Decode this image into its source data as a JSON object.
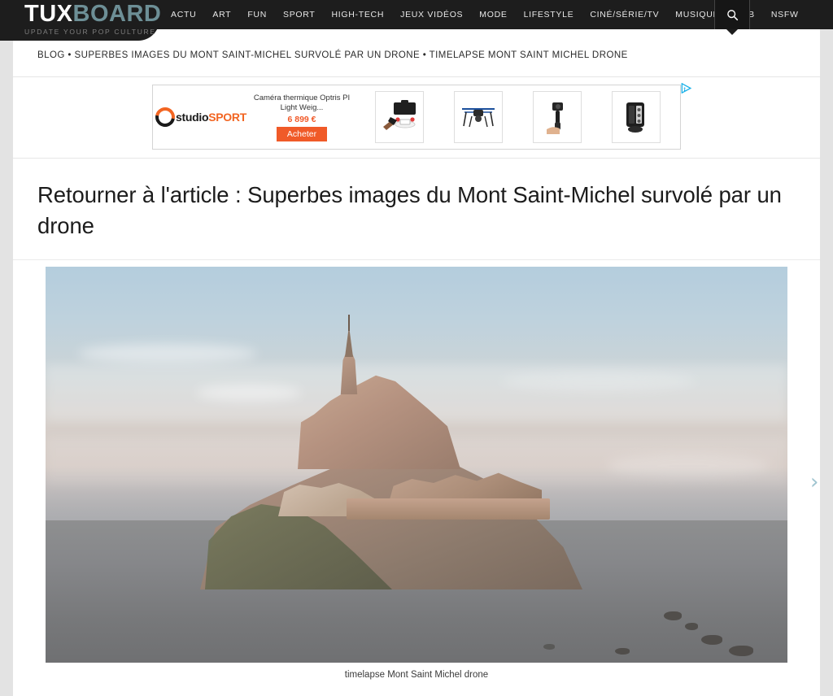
{
  "site": {
    "logo_primary": "TUX",
    "logo_secondary": "BOARD",
    "tagline": "UPDATE YOUR POP CULTURE",
    "accent_color": "#6d8f96",
    "header_bg": "#1d1d1d"
  },
  "nav": {
    "items": [
      {
        "label": "ACTU"
      },
      {
        "label": "ART"
      },
      {
        "label": "FUN"
      },
      {
        "label": "SPORT"
      },
      {
        "label": "HIGH-TECH"
      },
      {
        "label": "JEUX VIDÉOS"
      },
      {
        "label": "MODE"
      },
      {
        "label": "LIFESTYLE"
      },
      {
        "label": "CINÉ/SÉRIE/TV"
      },
      {
        "label": "MUSIQUE"
      },
      {
        "label": "PUB"
      },
      {
        "label": "NSFW"
      }
    ],
    "search_icon": "search-icon"
  },
  "breadcrumb": {
    "text": "BLOG • SUPERBES IMAGES DU MONT SAINT-MICHEL SURVOLÉ PAR UN DRONE • TIMELAPSE MONT SAINT MICHEL DRONE"
  },
  "ad": {
    "brand_part1": "studio",
    "brand_part2": "SPORT",
    "product_title": "Caméra thermique Optris PI Light Weig...",
    "price": "6 899 €",
    "price_color": "#f15a29",
    "buy_label": "Acheter",
    "adchoices_icon": "adchoices-icon",
    "thumbnails": [
      {
        "name": "drone-case-thumbnail"
      },
      {
        "name": "blue-quadcopter-thumbnail"
      },
      {
        "name": "gimbal-stabilizer-thumbnail"
      },
      {
        "name": "action-camera-thumbnail"
      }
    ]
  },
  "article": {
    "title": "Retourner à l'article : Superbes images du Mont Saint-Michel survolé par un drone"
  },
  "viewer": {
    "prev_icon": "‹",
    "next_icon": "›",
    "arrow_color": "#9fc4d0",
    "photo_alt": "mont-saint-michel-aerial-photo",
    "caption": "timelapse Mont Saint Michel drone"
  }
}
